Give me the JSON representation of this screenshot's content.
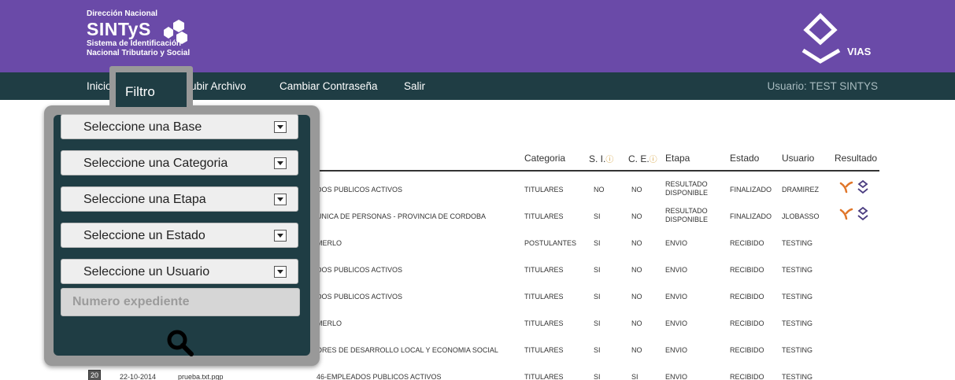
{
  "header": {
    "org_small": "Dirección Nacional",
    "org_name": "SINTyS",
    "org_sub1": "Sistema de Identificación",
    "org_sub2": "Nacional Tributario y Social",
    "vias_label": "VIAS",
    "brand_color": "#6a4aa8",
    "nav_color": "#1f3d44"
  },
  "nav": {
    "items": [
      "Inicio",
      "Subir Archivo",
      "Cambiar Contraseña",
      "Salir"
    ],
    "user": "Usuario: TEST SINTYS"
  },
  "table": {
    "headers": {
      "categoria": "Categoria",
      "si": "S. I.",
      "ce": "C. E.",
      "etapa": "Etapa",
      "estado": "Estado",
      "usuario": "Usuario",
      "resultado": "Resultado"
    },
    "rows": [
      {
        "name": "DOS PUBLICOS ACTIVOS",
        "categoria": "TITULARES",
        "si": "NO",
        "ce": "NO",
        "etapa1": "RESULTADO",
        "etapa2": "DISPONIBLE",
        "estado": "FINALIZADO",
        "usuario": "DRAMIREZ",
        "has_result": true
      },
      {
        "name": "UNICA DE PERSONAS - PROVINCIA DE CORDOBA",
        "categoria": "TITULARES",
        "si": "SI",
        "ce": "NO",
        "etapa1": "RESULTADO",
        "etapa2": "DISPONIBLE",
        "estado": "FINALIZADO",
        "usuario": "JLOBASSO",
        "has_result": true
      },
      {
        "name": "MERLO",
        "categoria": "POSTULANTES",
        "si": "SI",
        "ce": "NO",
        "etapa1": "ENVIO",
        "etapa2": "",
        "estado": "RECIBIDO",
        "usuario": "TESTING",
        "has_result": false
      },
      {
        "name": "DOS PUBLICOS ACTIVOS",
        "categoria": "TITULARES",
        "si": "SI",
        "ce": "NO",
        "etapa1": "ENVIO",
        "etapa2": "",
        "estado": "RECIBIDO",
        "usuario": "TESTING",
        "has_result": false
      },
      {
        "name": "DOS PUBLICOS ACTIVOS",
        "categoria": "TITULARES",
        "si": "SI",
        "ce": "NO",
        "etapa1": "ENVIO",
        "etapa2": "",
        "estado": "RECIBIDO",
        "usuario": "TESTING",
        "has_result": false
      },
      {
        "name": "MERLO",
        "categoria": "TITULARES",
        "si": "SI",
        "ce": "NO",
        "etapa1": "ENVIO",
        "etapa2": "",
        "estado": "RECIBIDO",
        "usuario": "TESTING",
        "has_result": false
      },
      {
        "name": "ORES DE DESARROLLO LOCAL Y ECONOMIA SOCIAL",
        "categoria": "TITULARES",
        "si": "SI",
        "ce": "NO",
        "etapa1": "ENVIO",
        "etapa2": "",
        "estado": "RECIBIDO",
        "usuario": "TESTING",
        "has_result": false
      },
      {
        "name": "46-EMPLEADOS PUBLICOS ACTIVOS",
        "categoria": "TITULARES",
        "si": "SI",
        "ce": "SI",
        "etapa1": "ENVIO",
        "etapa2": "",
        "estado": "RECIBIDO",
        "usuario": "TESTING",
        "has_result": false
      }
    ],
    "last_row": {
      "badge": "20",
      "date": "22-10-2014",
      "file": "prueba.txt.pgp"
    }
  },
  "filter": {
    "tab_label": "Filtro",
    "selects": [
      "Seleccione una Base",
      "Seleccione una Categoria",
      "Seleccione una Etapa",
      "Seleccione un Estado",
      "Seleccione un Usuario"
    ],
    "expediente_placeholder": "Numero expediente",
    "search_icon": "search-icon"
  },
  "icons": {
    "result_icon_color": "#e0762a",
    "vias_icon_color": "#4a3c80"
  }
}
